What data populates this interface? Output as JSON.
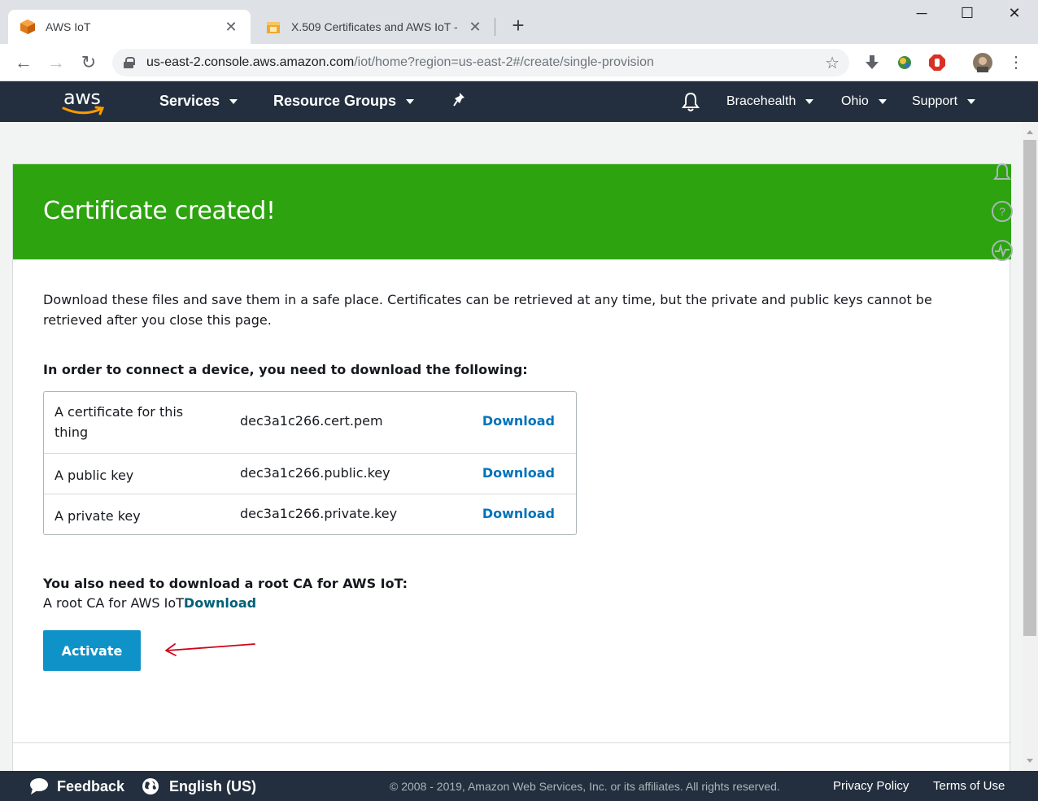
{
  "browser": {
    "tabs": [
      {
        "title": "AWS IoT",
        "icon": "aws-cube-icon"
      },
      {
        "title": "X.509 Certificates and AWS IoT - ",
        "icon": "docs-box-icon"
      }
    ],
    "url_host": "us-east-2.console.aws.amazon.com",
    "url_path": "/iot/home?region=us-east-2#/create/single-provision"
  },
  "awsnav": {
    "logo_text": "aws",
    "services": "Services",
    "resource_groups": "Resource Groups",
    "account": "Bracehealth",
    "region": "Ohio",
    "support": "Support"
  },
  "page": {
    "banner_title": "Certificate created!",
    "description": "Download these files and save them in a safe place. Certificates can be retrieved at any time, but the private and public keys cannot be retrieved after you close this page.",
    "files_heading": "In order to connect a device, you need to download the following:",
    "files": [
      {
        "label": "A certificate for this thing",
        "filename": "dec3a1c266.cert.pem",
        "action": "Download"
      },
      {
        "label": "A public key",
        "filename": "dec3a1c266.public.key",
        "action": "Download"
      },
      {
        "label": "A private key",
        "filename": "dec3a1c266.private.key",
        "action": "Download"
      }
    ],
    "rootca_heading": "You also need to download a root CA for AWS IoT:",
    "rootca_label": "A root CA for AWS IoT",
    "rootca_action": "Download",
    "activate_label": "Activate"
  },
  "footer": {
    "feedback": "Feedback",
    "language": "English (US)",
    "copyright": "© 2008 - 2019, Amazon Web Services, Inc. or its affiliates. All rights reserved.",
    "privacy": "Privacy Policy",
    "terms": "Terms of Use"
  },
  "colors": {
    "banner_green": "#2ca30f",
    "link_blue": "#0073bb",
    "activate_blue": "#0f92c8",
    "nav_dark": "#232f3e",
    "annotation_red": "#d0021b"
  }
}
